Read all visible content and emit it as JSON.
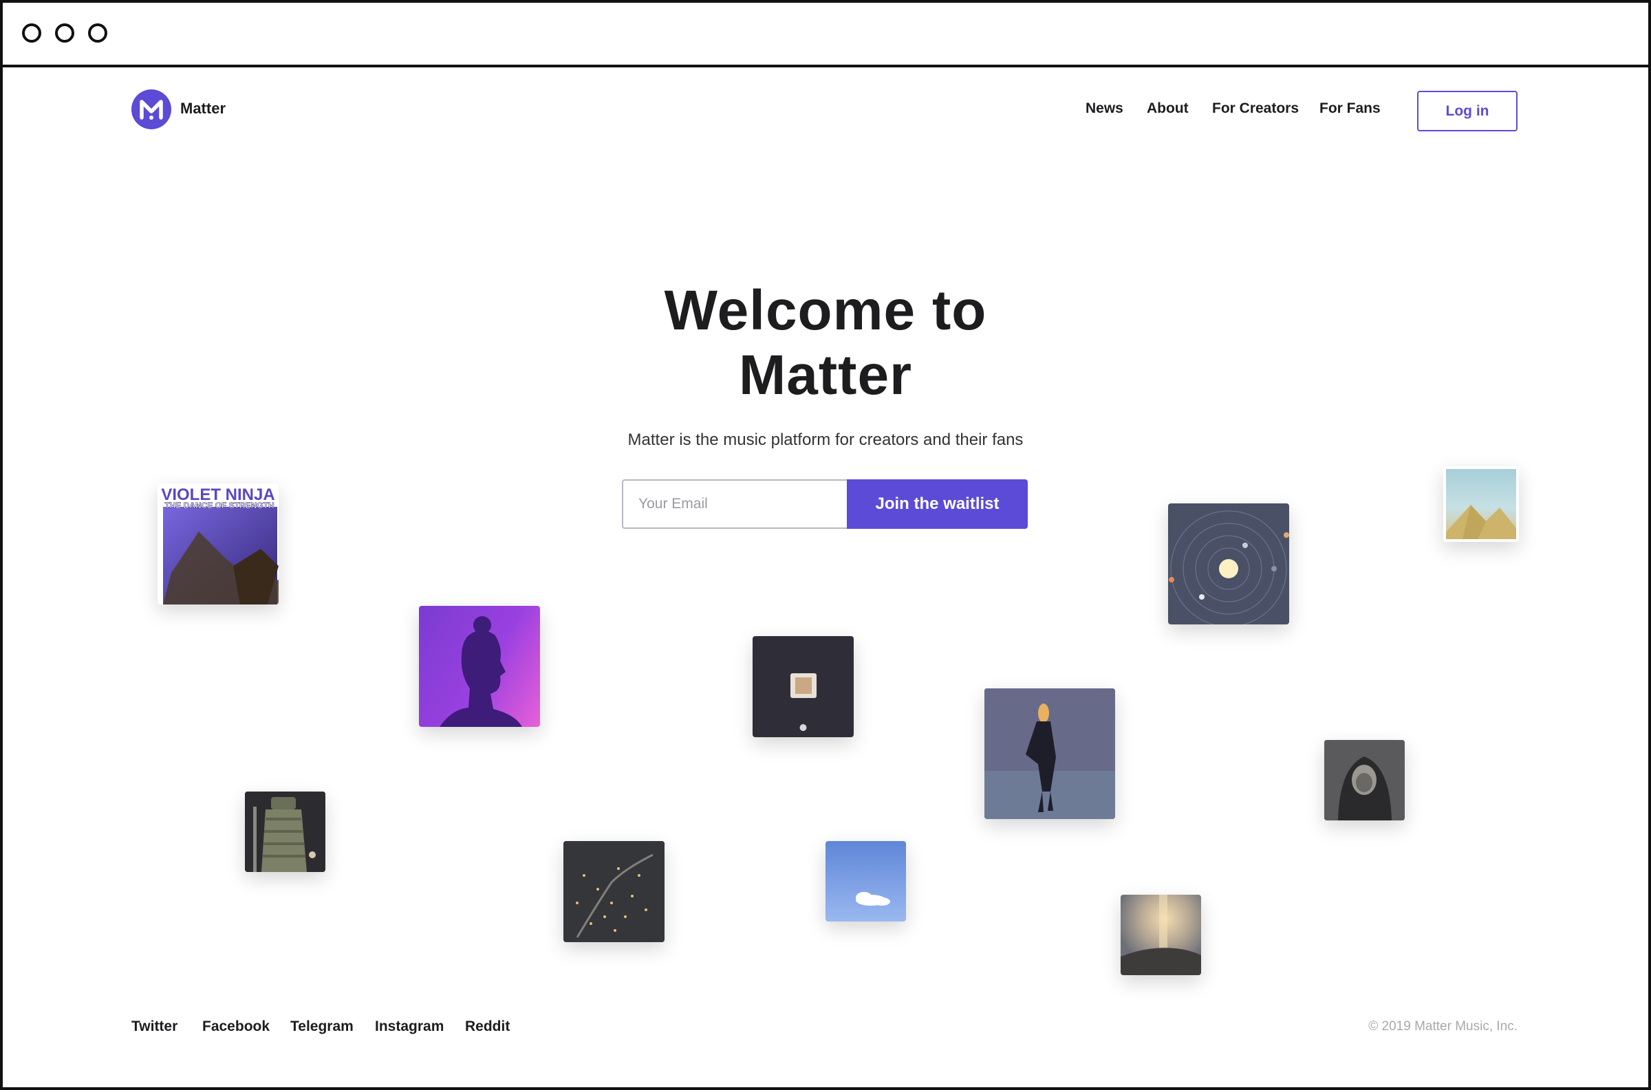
{
  "header": {
    "brand": "Matter",
    "nav": [
      "News",
      "About",
      "For Creators",
      "For Fans"
    ],
    "login_label": "Log in",
    "accent_color": "#5b4bd6"
  },
  "hero": {
    "title_line1": "Welcome to",
    "title_line2": "Matter",
    "subtitle": "Matter is the music platform for creators and their fans",
    "email_placeholder": "Your Email",
    "join_label": "Join the waitlist"
  },
  "artworks": {
    "violet_ninja": {
      "line1": "VIOLET NINJA",
      "line2": "THE DANCE OF STRENGTH"
    }
  },
  "footer": {
    "links": [
      "Twitter",
      "Facebook",
      "Telegram",
      "Instagram",
      "Reddit"
    ],
    "copyright": "© 2019 Matter Music, Inc."
  }
}
